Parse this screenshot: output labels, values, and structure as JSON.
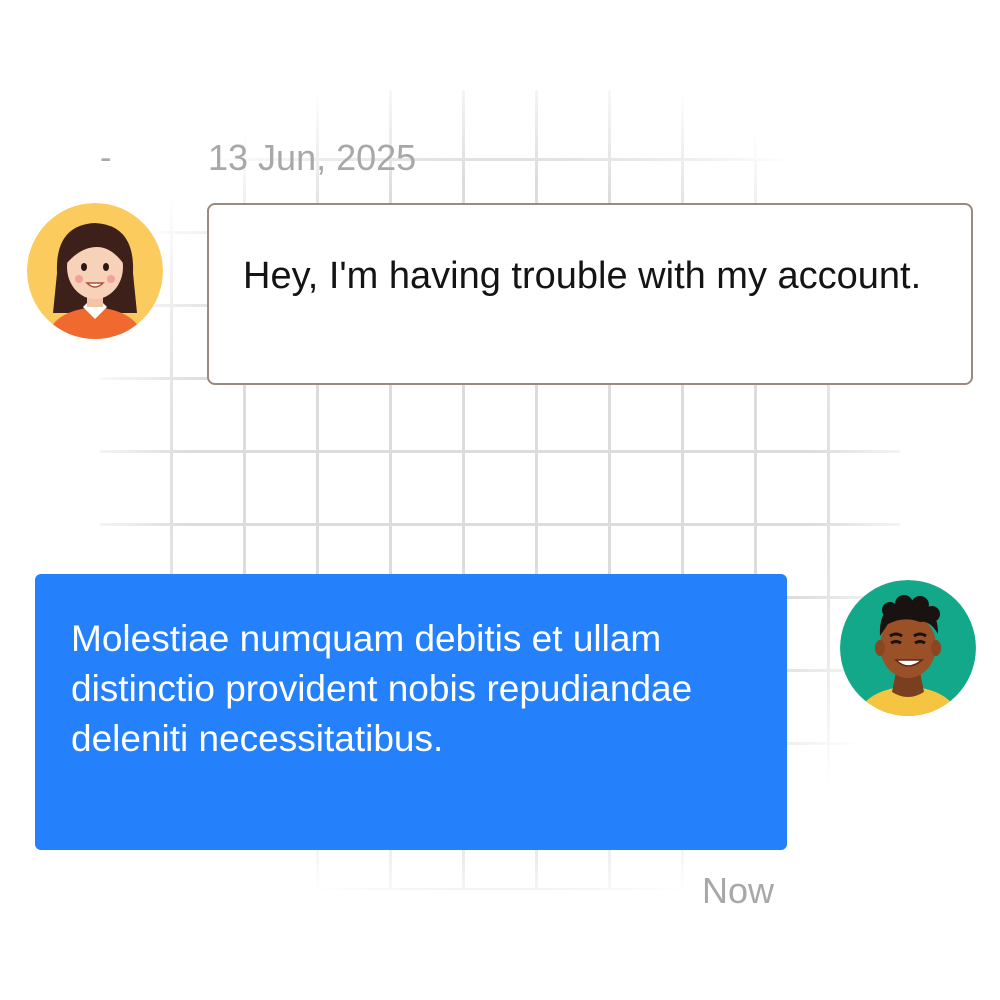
{
  "conversation": {
    "date_separator": "-",
    "date": "13 Jun, 2025",
    "messages": [
      {
        "sender": "customer",
        "avatar_icon": "woman-avatar-icon",
        "text": "Hey, I'm having trouble with my account.",
        "bubble_color": "#ffffff",
        "border_color": "#9b8a80"
      },
      {
        "sender": "agent",
        "avatar_icon": "man-avatar-icon",
        "text": "Molestiae numquam debitis et ullam distinctio provident nobis repudiandae deleniti necessitatibus.",
        "bubble_color": "#2480fb"
      }
    ],
    "timestamp": "Now"
  },
  "colors": {
    "accent_blue": "#2480fb",
    "muted_text": "#a8a8a8",
    "grid_line": "#dcdcdc"
  }
}
